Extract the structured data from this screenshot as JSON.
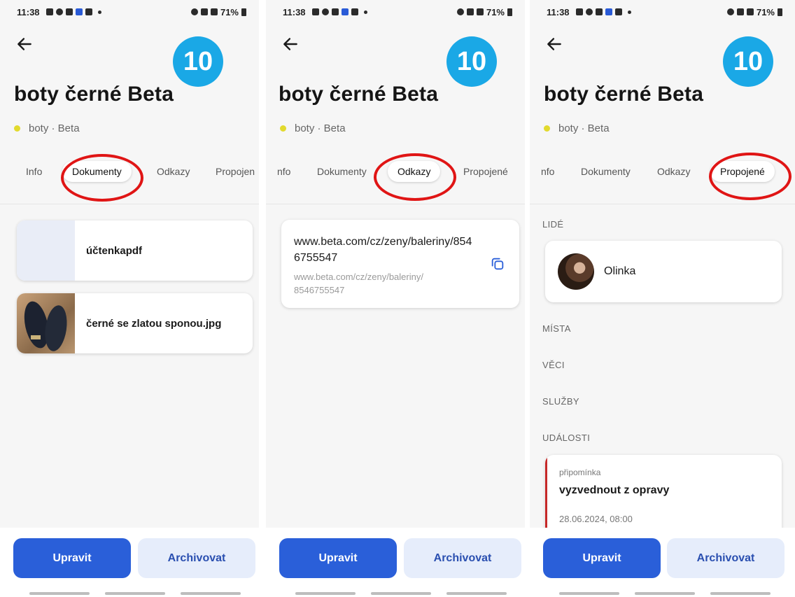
{
  "status": {
    "time": "11:38",
    "battery": "71%"
  },
  "item": {
    "badge": "10",
    "title": "boty černé Beta",
    "subtitle": "boty · Beta"
  },
  "tabs": {
    "info": "Info",
    "documents": "Dokumenty",
    "links": "Odkazy",
    "linked": "Propojené",
    "linked_truncated": "Propojen",
    "info_truncated": "nfo"
  },
  "documents": [
    {
      "name": "účtenkapdf"
    },
    {
      "name": "černé se zlatou sponou.jpg"
    }
  ],
  "link": {
    "url": "www.beta.com/cz/zeny/baleriny/8546755547",
    "url_line1": "www.beta.com/cz/zeny/baleriny/",
    "url_line2": "8546755547"
  },
  "linked": {
    "people_label": "LIDÉ",
    "person_name": "Olinka",
    "places_label": "MÍSTA",
    "things_label": "VĚCI",
    "services_label": "SLUŽBY",
    "events_label": "UDÁLOSTI",
    "event": {
      "type": "připomínka",
      "title": "vyzvednout z opravy",
      "date": "28.06.2024, 08:00"
    }
  },
  "actions": {
    "edit": "Upravit",
    "archive": "Archivovat"
  },
  "colors": {
    "accent": "#2a5fd9",
    "badge": "#1aa8e6",
    "highlight": "#e01515",
    "dot": "#e2da2e"
  }
}
